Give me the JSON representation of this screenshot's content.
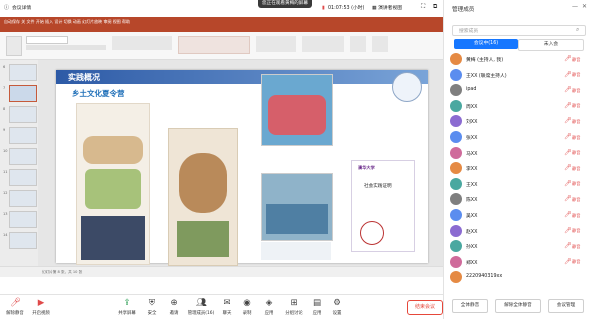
{
  "meeting": {
    "share_notice": "您正在观看黄梅的屏幕",
    "meeting_id_label": "会议详情",
    "timer": "01:07:53",
    "talking": "01:07:53 (小时)",
    "view_label": "演讲者视图",
    "colors": {
      "accent": "#1677ff",
      "danger": "#e6473a",
      "mic_muted": "#e04a4a"
    }
  },
  "ppt": {
    "title_text": "自动保存  关  文件  开始  插入  设计  切换  动画  幻灯片放映  审阅  视图  帮助",
    "status_text": "幻灯片第 8 张，共 10 张",
    "thumbs": [
      "6",
      "7",
      "8",
      "9",
      "10",
      "11",
      "12",
      "13",
      "14"
    ],
    "slide": {
      "header": "实践概况",
      "subheader": "乡土文化夏令营",
      "cert_school": "清华大学",
      "cert_title": "社会实践证明"
    }
  },
  "toolbar": {
    "items": [
      {
        "label": "解除静音",
        "icon": "mic-icon"
      },
      {
        "label": "开启视频",
        "icon": "video-icon"
      },
      {
        "label": "共享屏幕",
        "icon": "share-icon"
      },
      {
        "label": "安全",
        "icon": "shield-icon"
      },
      {
        "label": "邀请",
        "icon": "invite-icon"
      },
      {
        "label": "管理成员(16)",
        "icon": "members-icon"
      },
      {
        "label": "聊天",
        "icon": "chat-icon"
      },
      {
        "label": "录制",
        "icon": "record-icon"
      },
      {
        "label": "应用",
        "icon": "apps-icon"
      },
      {
        "label": "分组讨论",
        "icon": "breakout-icon"
      },
      {
        "label": "应用",
        "icon": "apps-icon"
      },
      {
        "label": "设置",
        "icon": "gear-icon"
      }
    ],
    "leave_label": "结束会议"
  },
  "panel": {
    "title": "管理成员",
    "search_placeholder": "搜索成员",
    "tab_in_meeting": "会议中(16)",
    "tab_waiting": "未入会",
    "members": [
      {
        "name": "黄梅 (主持人, 我)",
        "color": "#e58a44",
        "muted": "静音"
      },
      {
        "name": "王XX (联席主持人)",
        "color": "#5b8def",
        "muted": "静音"
      },
      {
        "name": "ipad",
        "color": "#7f7f7f",
        "muted": "静音"
      },
      {
        "name": "周XX",
        "color": "#4aa8a0",
        "muted": "静音"
      },
      {
        "name": "刘XX",
        "color": "#8b6bd1",
        "muted": "静音"
      },
      {
        "name": "张XX",
        "color": "#5b8def",
        "muted": "静音"
      },
      {
        "name": "马XX",
        "color": "#cf6b9b",
        "muted": "静音"
      },
      {
        "name": "李XX",
        "color": "#e58a44",
        "muted": "静音"
      },
      {
        "name": "王XX",
        "color": "#4aa8a0",
        "muted": "静音"
      },
      {
        "name": "陈XX",
        "color": "#7f7f7f",
        "muted": "静音"
      },
      {
        "name": "吴XX",
        "color": "#5b8def",
        "muted": "静音"
      },
      {
        "name": "赵XX",
        "color": "#8b6bd1",
        "muted": "静音"
      },
      {
        "name": "孙XX",
        "color": "#4aa8a0",
        "muted": "静音"
      },
      {
        "name": "郑XX",
        "color": "#cf6b9b",
        "muted": "静音"
      },
      {
        "name": "2220940319xx",
        "color": "#e58a44",
        "muted": ""
      }
    ],
    "btn_mute_all": "全体静音",
    "btn_unmute_all": "解除全体静音",
    "btn_manage": "会议管理"
  }
}
